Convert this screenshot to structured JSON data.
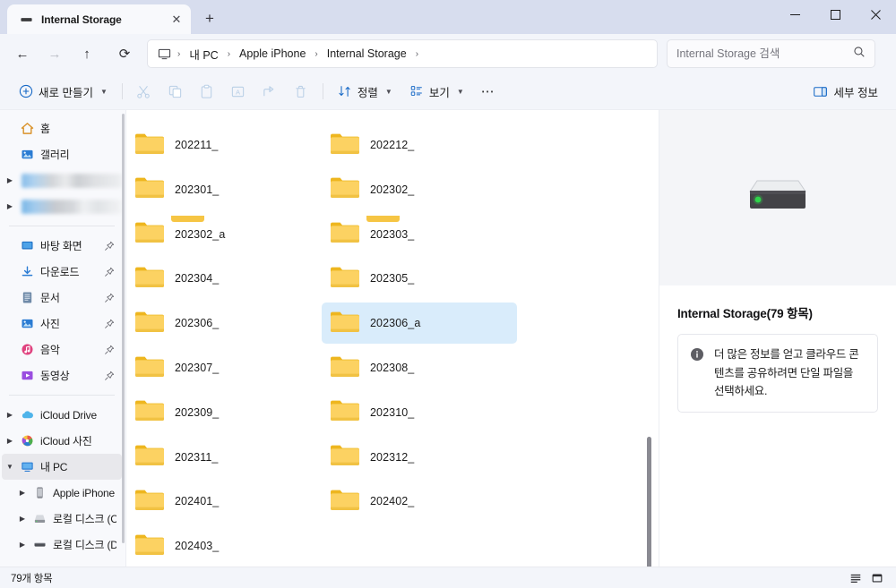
{
  "window": {
    "tab": {
      "label": "Internal Storage",
      "icon": "drive-icon",
      "close_label": "✕"
    },
    "new_tab_label": "+",
    "controls": {
      "minimize": "—",
      "maximize": "◻",
      "close": "✕"
    }
  },
  "addressbar": {
    "back": "←",
    "forward": "→",
    "up": "↑",
    "refresh": "⟳",
    "crumbs": [
      {
        "label": "내 PC"
      },
      {
        "label": "Apple iPhone"
      },
      {
        "label": "Internal Storage"
      }
    ],
    "separator": "›",
    "search": {
      "placeholder": "Internal Storage 검색",
      "value": "",
      "icon": "search-icon"
    }
  },
  "toolbar": {
    "new_label": "새로 만들기",
    "cut_label": "잘라내기",
    "copy_label": "복사",
    "paste_label": "붙여넣기",
    "rename_label": "이름 바꾸기",
    "share_label": "공유",
    "delete_label": "삭제",
    "sort_label": "정렬",
    "view_label": "보기",
    "more_label": "⋯",
    "details_label": "세부 정보"
  },
  "sidebar": {
    "items": [
      {
        "label": "홈",
        "icon": "home-icon",
        "arrow": false,
        "pin": false,
        "indent": false,
        "selected": false
      },
      {
        "label": "갤러리",
        "icon": "gallery-icon",
        "arrow": false,
        "pin": false,
        "indent": false,
        "selected": false
      },
      {
        "label": "",
        "icon": "blurred",
        "arrow": true,
        "pin": false,
        "indent": false,
        "selected": false,
        "blurred": true
      },
      {
        "label": "",
        "icon": "blurred",
        "arrow": true,
        "pin": false,
        "indent": false,
        "selected": false,
        "blurred": true
      },
      {
        "divider": true
      },
      {
        "label": "바탕 화면",
        "icon": "desktop-icon",
        "arrow": false,
        "pin": true,
        "indent": false,
        "selected": false
      },
      {
        "label": "다운로드",
        "icon": "downloads-icon",
        "arrow": false,
        "pin": true,
        "indent": false,
        "selected": false
      },
      {
        "label": "문서",
        "icon": "documents-icon",
        "arrow": false,
        "pin": true,
        "indent": false,
        "selected": false
      },
      {
        "label": "사진",
        "icon": "pictures-icon",
        "arrow": false,
        "pin": true,
        "indent": false,
        "selected": false
      },
      {
        "label": "음악",
        "icon": "music-icon",
        "arrow": false,
        "pin": true,
        "indent": false,
        "selected": false
      },
      {
        "label": "동영상",
        "icon": "videos-icon",
        "arrow": false,
        "pin": true,
        "indent": false,
        "selected": false
      },
      {
        "divider": true
      },
      {
        "label": "iCloud Drive",
        "icon": "icloud-drive-icon",
        "arrow": true,
        "pin": false,
        "indent": false,
        "selected": false
      },
      {
        "label": "iCloud 사진",
        "icon": "icloud-photos-icon",
        "arrow": true,
        "pin": false,
        "indent": false,
        "selected": false
      },
      {
        "label": "내 PC",
        "icon": "this-pc-icon",
        "arrow": true,
        "expanded": true,
        "pin": false,
        "indent": false,
        "selected": true
      },
      {
        "label": "Apple iPhone",
        "icon": "iphone-icon",
        "arrow": true,
        "pin": false,
        "indent": true,
        "selected": false
      },
      {
        "label": "로컬 디스크 (C",
        "icon": "local-disk-c-icon",
        "arrow": true,
        "pin": false,
        "indent": true,
        "selected": false
      },
      {
        "label": "로컬 디스크 (D",
        "icon": "local-disk-d-icon",
        "arrow": true,
        "pin": false,
        "indent": true,
        "selected": false
      }
    ]
  },
  "files": {
    "columns": [
      [
        {
          "name": "202211_",
          "selected": false
        },
        {
          "name": "202301_",
          "selected": false
        },
        {
          "name": "202302_a",
          "selected": false
        },
        {
          "name": "202304_",
          "selected": false
        },
        {
          "name": "202306_",
          "selected": false
        },
        {
          "name": "202307_",
          "selected": false
        },
        {
          "name": "202309_",
          "selected": false
        },
        {
          "name": "202311_",
          "selected": false
        },
        {
          "name": "202401_",
          "selected": false
        },
        {
          "name": "202403_",
          "selected": false
        }
      ],
      [
        {
          "name": "202212_",
          "selected": false
        },
        {
          "name": "202302_",
          "selected": false
        },
        {
          "name": "202303_",
          "selected": false
        },
        {
          "name": "202305_",
          "selected": false
        },
        {
          "name": "202306_a",
          "selected": true
        },
        {
          "name": "202308_",
          "selected": false
        },
        {
          "name": "202310_",
          "selected": false
        },
        {
          "name": "202312_",
          "selected": false
        },
        {
          "name": "202402_",
          "selected": false
        }
      ]
    ]
  },
  "details": {
    "preview_icon": "drive-icon",
    "title": "Internal Storage(79 항목)",
    "info_icon": "info-icon",
    "info_text": "더 많은 정보를 얻고 클라우드 콘텐츠를 공유하려면 단일 파일을 선택하세요."
  },
  "statusbar": {
    "item_count": "79개 항목",
    "list_view_label": "목록 보기",
    "icons_view_label": "큰 아이콘 보기"
  },
  "colors": {
    "accent": "#0067c0",
    "selection": "#d9ecfb",
    "folder": "#f6c544",
    "titlebar": "#d7ddee",
    "chrome": "#f3f5fa"
  }
}
